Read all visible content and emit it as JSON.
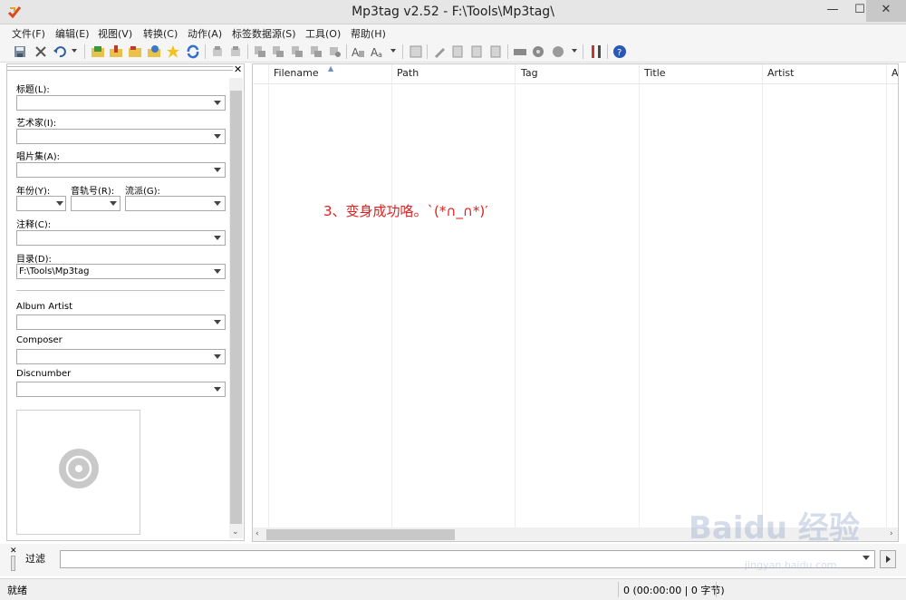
{
  "window": {
    "title": "Mp3tag v2.52  -  F:\\Tools\\Mp3tag\\"
  },
  "menu": [
    "文件(F)",
    "编辑(E)",
    "视图(V)",
    "转换(C)",
    "动作(A)",
    "标签数据源(S)",
    "工具(O)",
    "帮助(H)"
  ],
  "toolbar_icons": [
    "save-icon",
    "remove-tag-icon",
    "undo-icon",
    "open-folder-icon",
    "add-folder-icon",
    "playlist-icon",
    "favorite-icon",
    "refresh-icon",
    "copy-tag-icon",
    "paste-tag-icon",
    "convert-filename-tag-icon",
    "convert-tag-filename-icon",
    "convert-tag-tag-icon",
    "convert-text-filename-icon",
    "actions-icon",
    "quick-actions-icon",
    "extended-tags-icon",
    "edit-icon",
    "export-icon",
    "options-icon",
    "freedb-icon",
    "web-source-icon",
    "tools-icon",
    "help-icon"
  ],
  "panel": {
    "fields": [
      {
        "label": "标题(L):",
        "value": ""
      },
      {
        "label": "艺术家(I):",
        "value": ""
      },
      {
        "label": "唱片集(A):",
        "value": ""
      },
      {
        "label": "年份(Y):",
        "value": ""
      },
      {
        "label": "音轨号(R):",
        "value": ""
      },
      {
        "label": "流派(G):",
        "value": ""
      },
      {
        "label": "注释(C):",
        "value": ""
      },
      {
        "label": "目录(D):",
        "value": "F:\\Tools\\Mp3tag"
      },
      {
        "label": "Album Artist",
        "value": ""
      },
      {
        "label": "Composer",
        "value": ""
      },
      {
        "label": "Discnumber",
        "value": ""
      }
    ]
  },
  "grid": {
    "columns": [
      "Filename",
      "Path",
      "Tag",
      "Title",
      "Artist",
      "A"
    ],
    "annotation": "3、变身成功咯。`(*∩_∩*)′"
  },
  "filter": {
    "label": "过滤",
    "value": ""
  },
  "status": {
    "left": "就绪",
    "right": "0 (00:00:00 | 0 字节)"
  },
  "watermark": {
    "text": "Baidu 经验",
    "url": "jingyan.baidu.com"
  },
  "colors": {
    "annotation": "#e0201e",
    "titlebar": "#e6e6e6",
    "close_button": "#c8c8c8"
  }
}
